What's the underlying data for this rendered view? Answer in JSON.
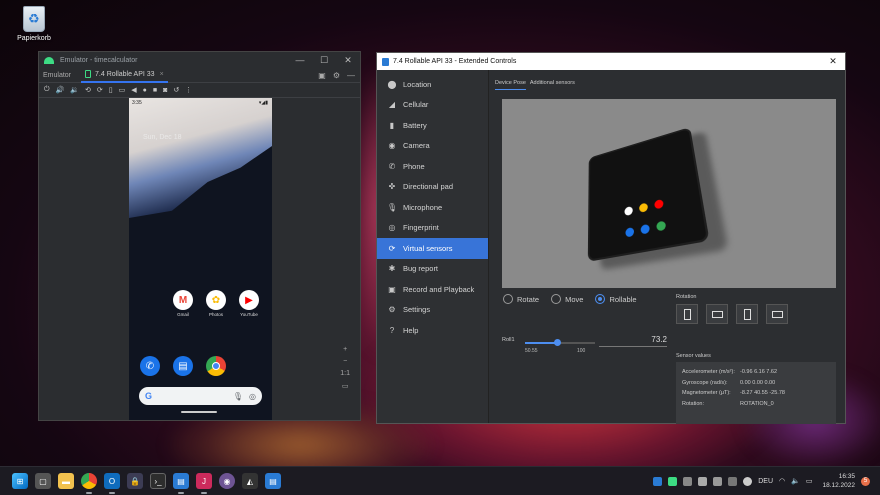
{
  "desktop": {
    "icon_label": "Papierkorb"
  },
  "emulator": {
    "title": "Emulator - timecalculator",
    "tab_label": "Emulator",
    "device_tab": "7.4 Rollable API 33",
    "phone": {
      "time": "3:35",
      "date_text": "Sun, Dec 18",
      "apps": [
        {
          "label": "Gmail",
          "color": "#ffffff"
        },
        {
          "label": "Photos",
          "color": "#ffffff"
        },
        {
          "label": "YouTube",
          "color": "#ffffff"
        }
      ],
      "dock": [
        {
          "name": "phone",
          "color": "#1a73e8"
        },
        {
          "name": "messages",
          "color": "#1a73e8"
        },
        {
          "name": "chrome",
          "color": "#ffffff"
        }
      ]
    },
    "side_controls": {
      "plus": "+",
      "minus": "−",
      "ratio": "1:1"
    }
  },
  "extended": {
    "title": "7.4 Rollable API 33 - Extended Controls",
    "nav": [
      {
        "label": "Location",
        "icon": "location-icon",
        "glyph": "⬤"
      },
      {
        "label": "Cellular",
        "icon": "cellular-icon",
        "glyph": "◢"
      },
      {
        "label": "Battery",
        "icon": "battery-icon",
        "glyph": "▮"
      },
      {
        "label": "Camera",
        "icon": "camera-icon",
        "glyph": "◉"
      },
      {
        "label": "Phone",
        "icon": "phone-icon",
        "glyph": "✆"
      },
      {
        "label": "Directional pad",
        "icon": "dpad-icon",
        "glyph": "✜"
      },
      {
        "label": "Microphone",
        "icon": "microphone-icon",
        "glyph": "🎙"
      },
      {
        "label": "Fingerprint",
        "icon": "fingerprint-icon",
        "glyph": "◎"
      },
      {
        "label": "Virtual sensors",
        "icon": "sensors-icon",
        "glyph": "⟳"
      },
      {
        "label": "Bug report",
        "icon": "bug-icon",
        "glyph": "✱"
      },
      {
        "label": "Record and Playback",
        "icon": "record-icon",
        "glyph": "▣"
      },
      {
        "label": "Settings",
        "icon": "gear-icon",
        "glyph": "⚙"
      },
      {
        "label": "Help",
        "icon": "help-icon",
        "glyph": "?"
      }
    ],
    "active_nav": 8,
    "sub_tabs": [
      "Device Pose",
      "Additional sensors"
    ],
    "modes": [
      "Rotate",
      "Move",
      "Rollable"
    ],
    "selected_mode": "Rollable",
    "rotation_title": "Rotation",
    "roll": {
      "label": "Roll1",
      "min": "50.55",
      "max": "100",
      "value": "73.2",
      "fraction": 0.46
    },
    "sensor_values": {
      "title": "Sensor values",
      "rows": [
        {
          "k": "Accelerometer (m/s²):",
          "v": "-0.96   6.16   7.62"
        },
        {
          "k": "Gyroscope (rad/s):",
          "v": "0.00   0.00   0.00"
        },
        {
          "k": "Magnetometer (μT):",
          "v": "-8.27   40.55   -25.78"
        },
        {
          "k": "Rotation:",
          "v": "ROTATION_0"
        }
      ]
    }
  },
  "taskbar": {
    "language": "DEU",
    "time": "16:35",
    "date": "18.12.2022",
    "notifications": "5"
  },
  "colors": {
    "accent": "#3874d8",
    "android_green": "#3ddc84"
  }
}
